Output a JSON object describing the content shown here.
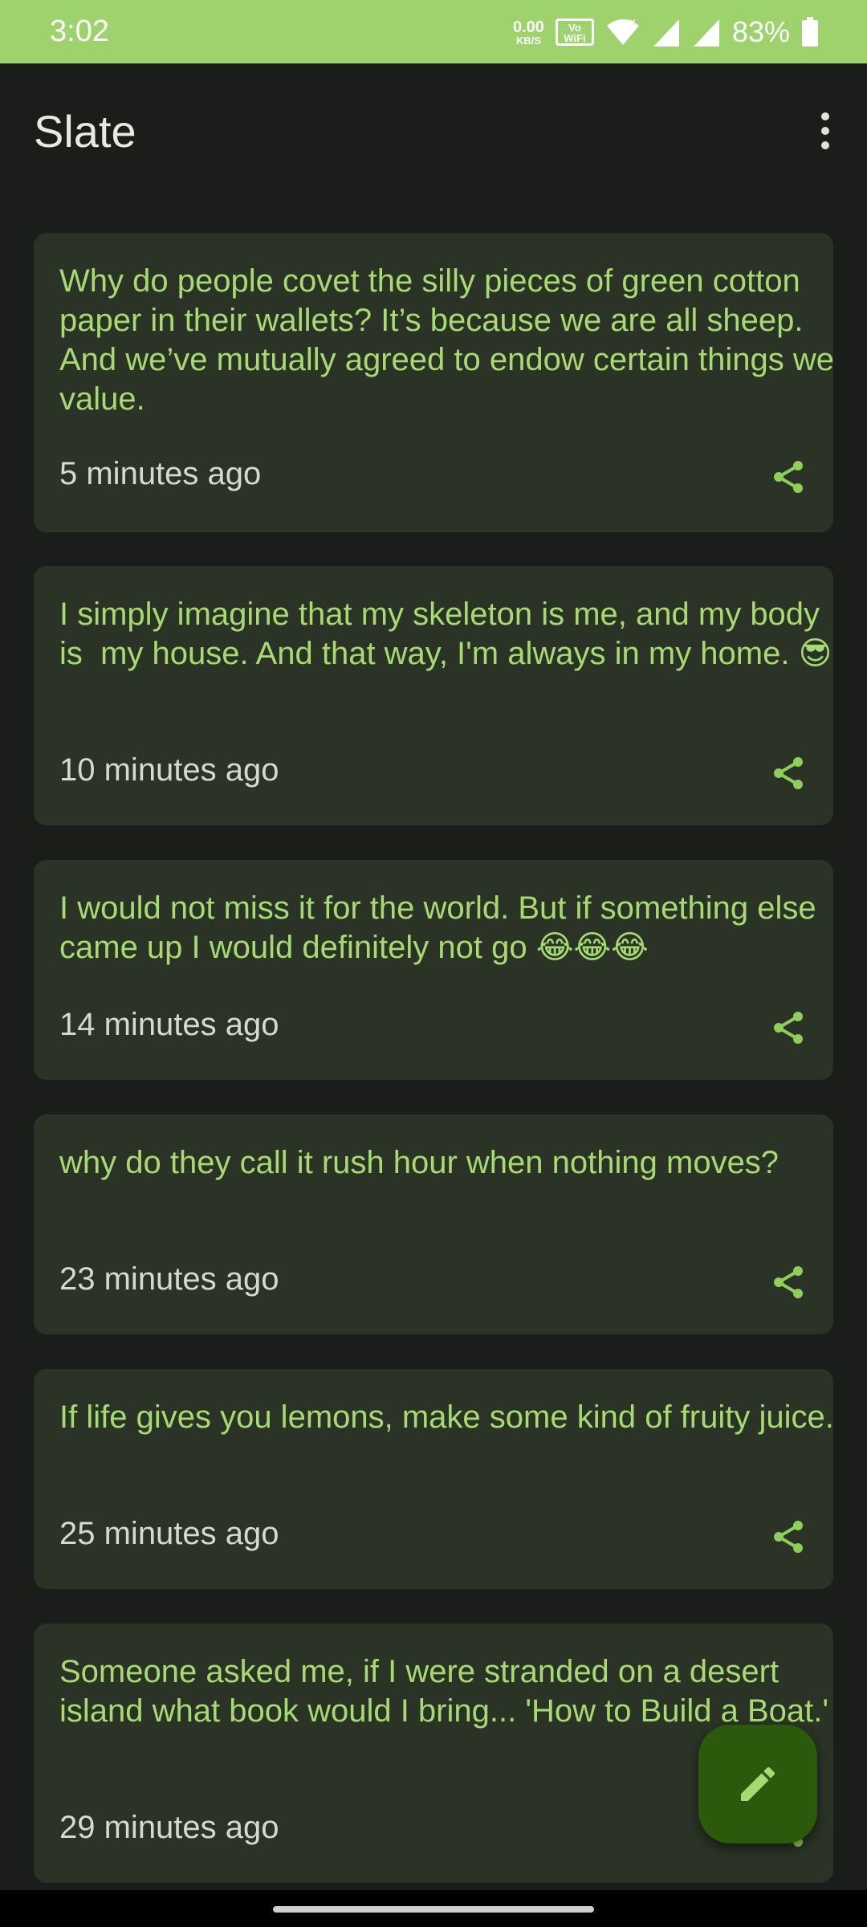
{
  "status_bar": {
    "time": "3:02",
    "net_speed_value": "0.00",
    "net_speed_unit": "KB/S",
    "vowifi_label": "Vo WiFi",
    "battery": "83%"
  },
  "app_bar": {
    "title": "Slate"
  },
  "notes": [
    {
      "text": "Why do people covet the silly pieces of green cotton paper in their wallets? It’s because we are all sheep. And we’ve mutually agreed to endow certain things we value.",
      "time": "5 minutes ago"
    },
    {
      "text": "I simply imagine that my skeleton is me, and my body is  my house. And that way, I'm always in my home. 😎",
      "time": "10 minutes ago"
    },
    {
      "text": "I would not miss it for the world. But if something else came up I would definitely not go 😂😂😂",
      "time": "14 minutes ago"
    },
    {
      "text": "why do they call it rush hour when nothing moves?",
      "time": "23 minutes ago"
    },
    {
      "text": "If life gives you lemons, make some kind of fruity juice.",
      "time": "25 minutes ago"
    },
    {
      "text": "Someone asked me, if I were stranded on a desert island what book would I bring... 'How to Build a Boat.'",
      "time": "29 minutes ago"
    }
  ],
  "colors": {
    "status_bar": "#9ed26c",
    "background": "#1b1d1a",
    "card": "#2a3325",
    "note_text": "#a6db72",
    "fab": "#2b5a0c"
  },
  "icons": {
    "overflow": "more-vert-icon",
    "share": "share-icon",
    "fab": "edit-pencil-icon"
  }
}
